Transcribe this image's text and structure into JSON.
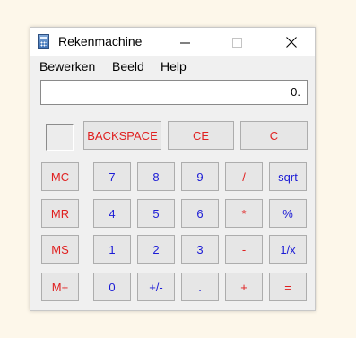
{
  "window": {
    "title": "Rekenmachine"
  },
  "menu": [
    "Bewerken",
    "Beeld",
    "Help"
  ],
  "display": {
    "value": "0."
  },
  "top_buttons": [
    "BACKSPACE",
    "CE",
    "C"
  ],
  "memory_buttons": [
    "MC",
    "MR",
    "MS",
    "M+"
  ],
  "keypad_rows": [
    [
      "7",
      "8",
      "9",
      "/",
      "sqrt"
    ],
    [
      "4",
      "5",
      "6",
      "*",
      "%"
    ],
    [
      "1",
      "2",
      "3",
      "-",
      "1/x"
    ],
    [
      "0",
      "+/-",
      ".",
      "+",
      "="
    ]
  ],
  "colors": {
    "red_label": "#e02020",
    "blue_label": "#1c1cd6",
    "button_face": "#e6e6e6"
  }
}
